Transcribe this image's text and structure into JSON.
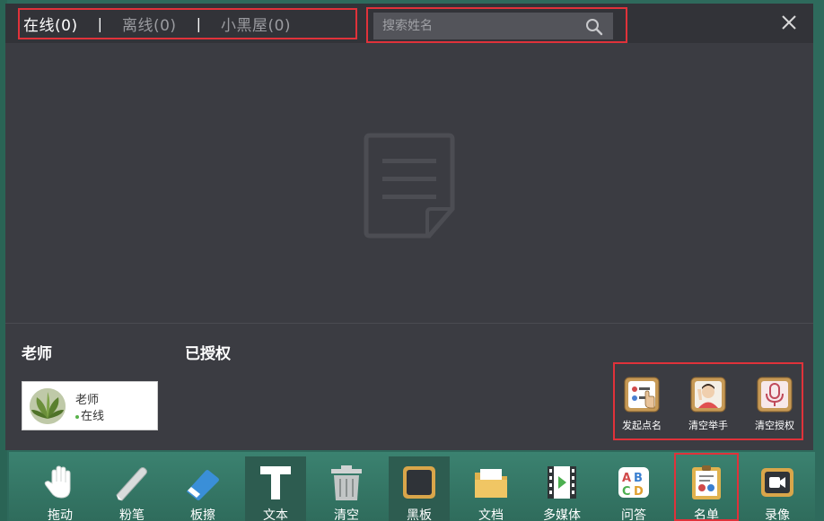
{
  "tabs": [
    {
      "label": "在线(0)",
      "active": true
    },
    {
      "label": "离线(0)",
      "active": false
    },
    {
      "label": "小黑屋(0)",
      "active": false
    }
  ],
  "separator": "|",
  "search": {
    "placeholder": "搜索姓名",
    "icon": "search-icon"
  },
  "close_icon": "close-icon",
  "empty_state_icon": "document-icon",
  "sections": {
    "teacher_title": "老师",
    "authorized_title": "已授权"
  },
  "teacher_card": {
    "name": "老师",
    "status": "在线",
    "status_color": "#58b24a"
  },
  "actions": [
    {
      "label": "发起点名",
      "icon": "roll-call-icon"
    },
    {
      "label": "清空举手",
      "icon": "clear-hands-icon"
    },
    {
      "label": "清空授权",
      "icon": "clear-auth-icon"
    }
  ],
  "toolbar": [
    {
      "label": "拖动",
      "icon": "hand-icon"
    },
    {
      "label": "粉笔",
      "icon": "chalk-icon"
    },
    {
      "label": "板擦",
      "icon": "eraser-icon"
    },
    {
      "label": "文本",
      "icon": "text-icon"
    },
    {
      "label": "清空",
      "icon": "trash-icon"
    },
    {
      "label": "黑板",
      "icon": "blackboard-icon"
    },
    {
      "label": "文档",
      "icon": "folder-icon"
    },
    {
      "label": "多媒体",
      "icon": "film-icon"
    },
    {
      "label": "问答",
      "icon": "qa-icon"
    },
    {
      "label": "名单",
      "icon": "roster-icon"
    },
    {
      "label": "录像",
      "icon": "record-icon"
    }
  ],
  "colors": {
    "highlight": "#e0323a",
    "panel": "#3b3c42",
    "header": "#323338",
    "toolbar": "#33735f"
  }
}
